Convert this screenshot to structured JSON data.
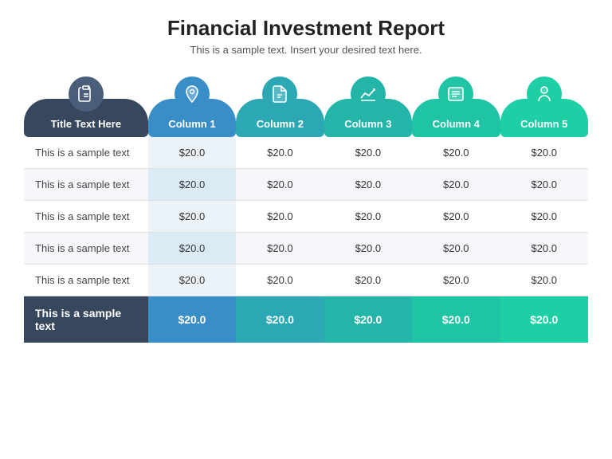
{
  "header": {
    "title": "Financial Investment Report",
    "subtitle": "This is a sample text. Insert your desired text here."
  },
  "table": {
    "title_column": {
      "label": "Title Text Here",
      "icon": "clipboard"
    },
    "columns": [
      {
        "id": "col1",
        "label": "Column 1",
        "icon": "pin",
        "color": "#3a8ec8"
      },
      {
        "id": "col2",
        "label": "Column 2",
        "icon": "file",
        "color": "#2ca8b4"
      },
      {
        "id": "col3",
        "label": "Column 3",
        "icon": "chart",
        "color": "#22b5a8"
      },
      {
        "id": "col4",
        "label": "Column 4",
        "icon": "list",
        "color": "#1ec4a4"
      },
      {
        "id": "col5",
        "label": "Column 5",
        "icon": "person",
        "color": "#1ecfa6"
      }
    ],
    "rows": [
      {
        "label": "This is a sample text",
        "values": [
          "$20.0",
          "$20.0",
          "$20.0",
          "$20.0",
          "$20.0"
        ]
      },
      {
        "label": "This is a sample text",
        "values": [
          "$20.0",
          "$20.0",
          "$20.0",
          "$20.0",
          "$20.0"
        ]
      },
      {
        "label": "This is a sample text",
        "values": [
          "$20.0",
          "$20.0",
          "$20.0",
          "$20.0",
          "$20.0"
        ]
      },
      {
        "label": "This is a sample text",
        "values": [
          "$20.0",
          "$20.0",
          "$20.0",
          "$20.0",
          "$20.0"
        ]
      },
      {
        "label": "This is a sample text",
        "values": [
          "$20.0",
          "$20.0",
          "$20.0",
          "$20.0",
          "$20.0"
        ]
      }
    ],
    "summary_row": {
      "label": "This is a sample text",
      "values": [
        "$20.0",
        "$20.0",
        "$20.0",
        "$20.0",
        "$20.0"
      ]
    }
  }
}
